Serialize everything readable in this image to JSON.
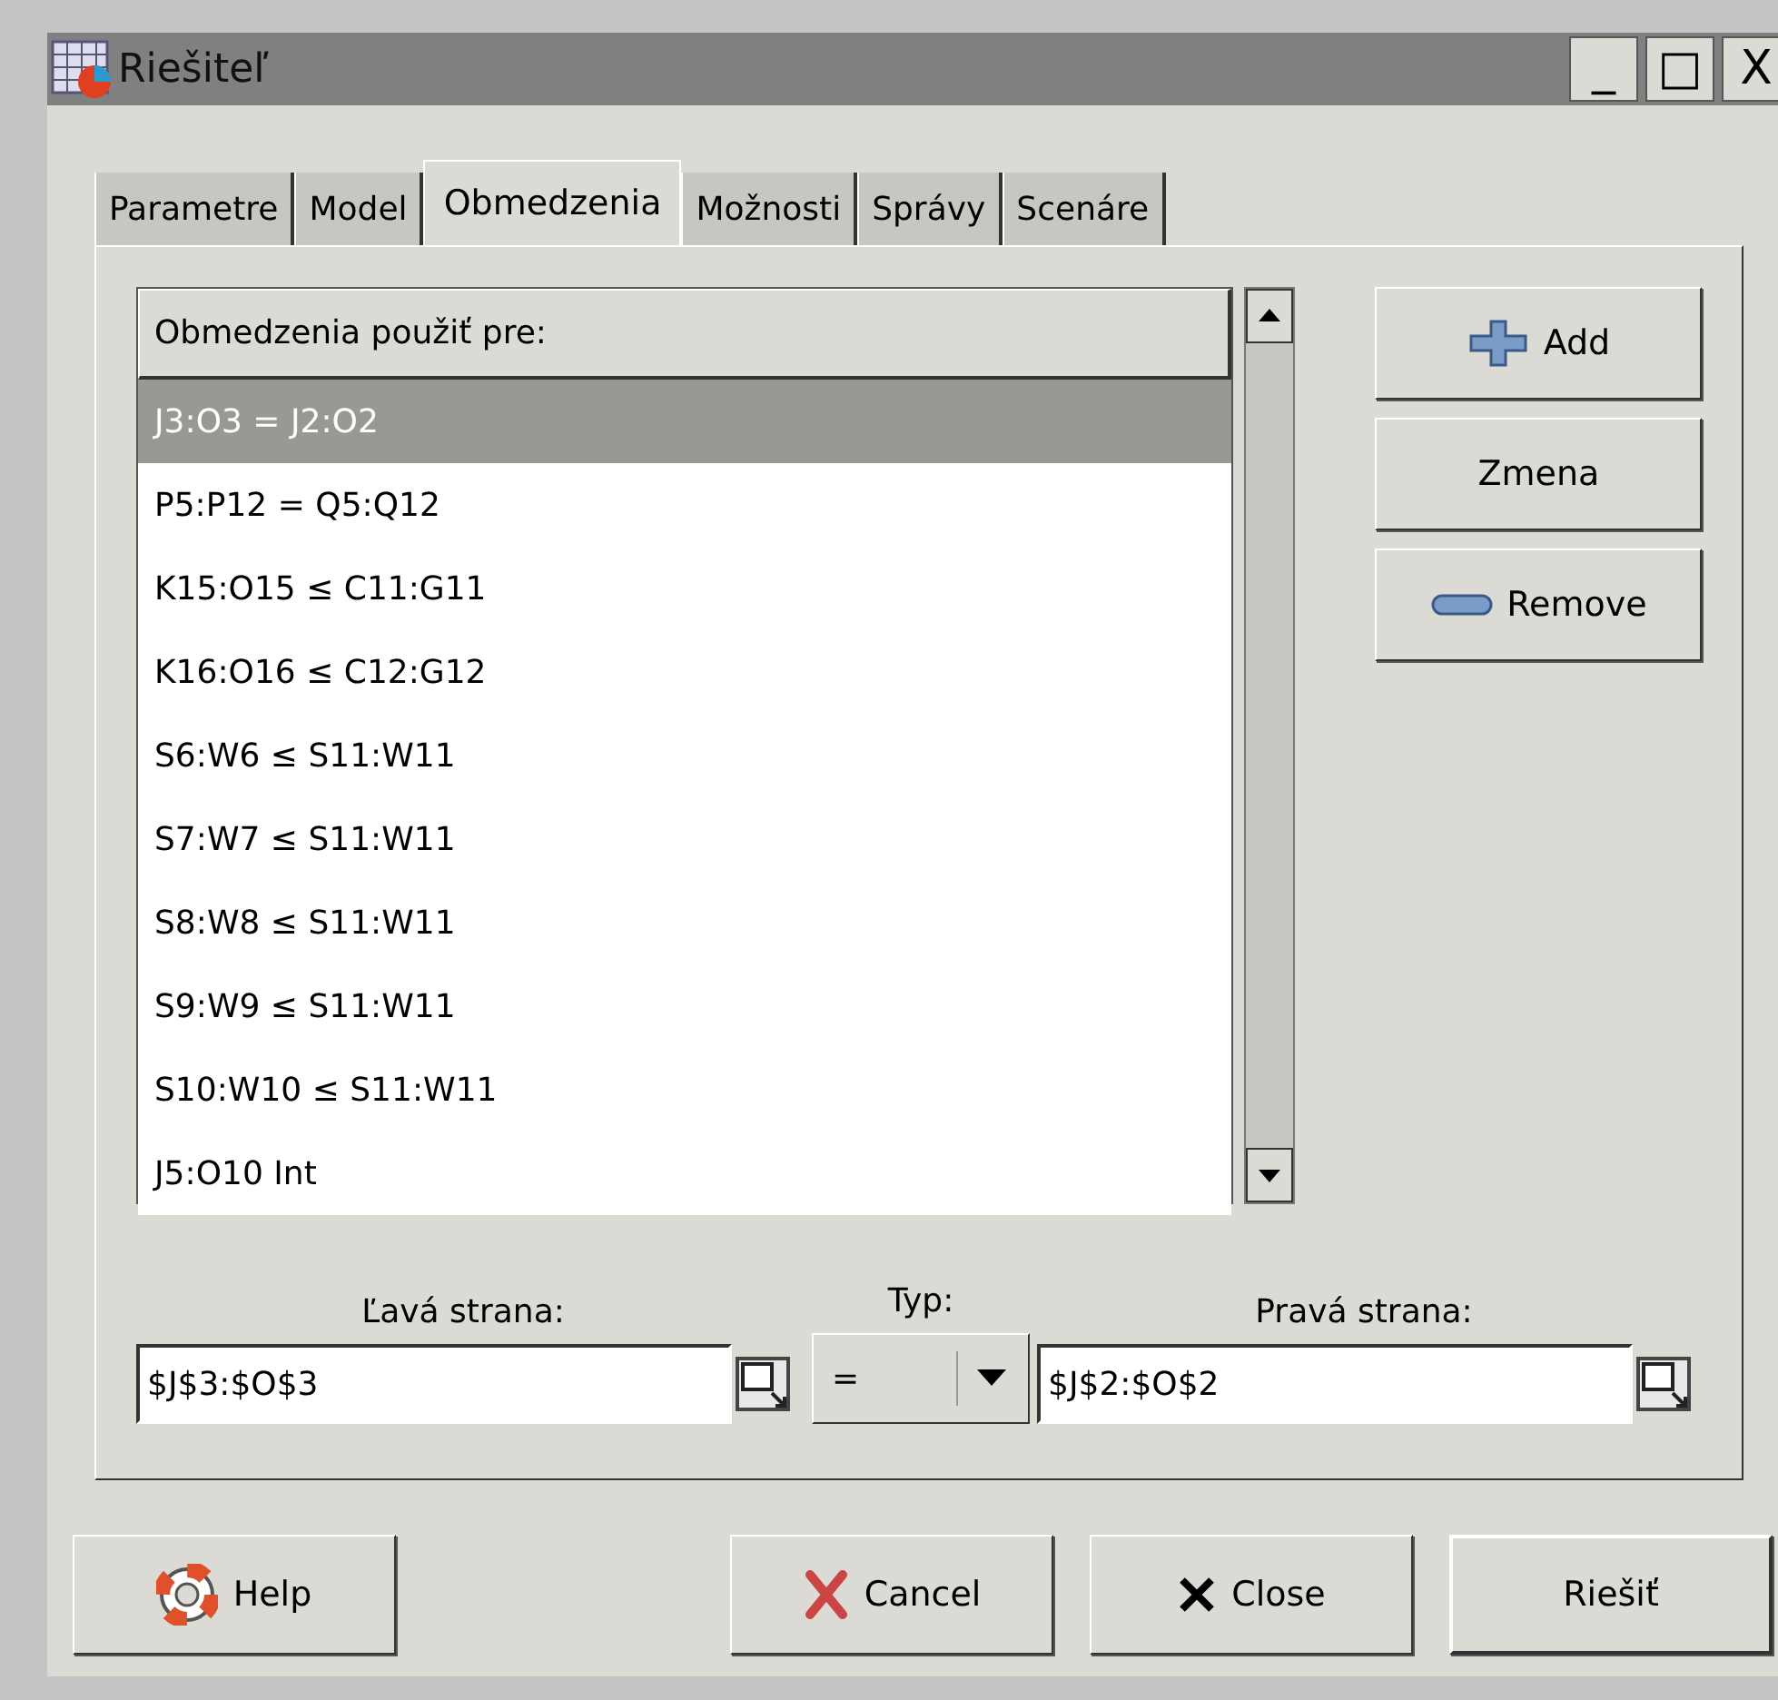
{
  "window": {
    "title": "Riešiteľ",
    "controls": [
      "_",
      "□",
      "X"
    ]
  },
  "tabs": [
    {
      "label": "Parametre",
      "selected": false
    },
    {
      "label": "Model",
      "selected": false
    },
    {
      "label": "Obmedzenia",
      "selected": true
    },
    {
      "label": "Možnosti",
      "selected": false
    },
    {
      "label": "Správy",
      "selected": false
    },
    {
      "label": "Scenáre",
      "selected": false
    }
  ],
  "list": {
    "header": "Obmedzenia použiť pre:",
    "rows": [
      {
        "text": "J3:O3 = J2:O2",
        "selected": true
      },
      {
        "text": "P5:P12 = Q5:Q12",
        "selected": false
      },
      {
        "text": "K15:O15 ≤ C11:G11",
        "selected": false
      },
      {
        "text": "K16:O16 ≤ C12:G12",
        "selected": false
      },
      {
        "text": "S6:W6 ≤ S11:W11",
        "selected": false
      },
      {
        "text": "S7:W7 ≤ S11:W11",
        "selected": false
      },
      {
        "text": "S8:W8 ≤ S11:W11",
        "selected": false
      },
      {
        "text": "S9:W9 ≤ S11:W11",
        "selected": false
      },
      {
        "text": "S10:W10 ≤ S11:W11",
        "selected": false
      },
      {
        "text": "J5:O10 Int",
        "selected": false
      }
    ]
  },
  "side_buttons": [
    {
      "label": "Add",
      "kind": "add"
    },
    {
      "label": "Zmena",
      "kind": "plain"
    },
    {
      "label": "Remove",
      "kind": "remove"
    }
  ],
  "left_side": {
    "label": "Ľavá strana:",
    "value": "$J$3:$O$3"
  },
  "type": {
    "label": "Typ:",
    "value": "="
  },
  "right_side": {
    "label": "Pravá strana:",
    "value": "$J$2:$O$2"
  },
  "bottom_buttons": [
    {
      "label": "Help",
      "kind": "help"
    },
    {
      "label": "Cancel",
      "kind": "cancel"
    },
    {
      "label": "Close",
      "kind": "close"
    },
    {
      "label": "Riešiť",
      "kind": "plain"
    }
  ]
}
